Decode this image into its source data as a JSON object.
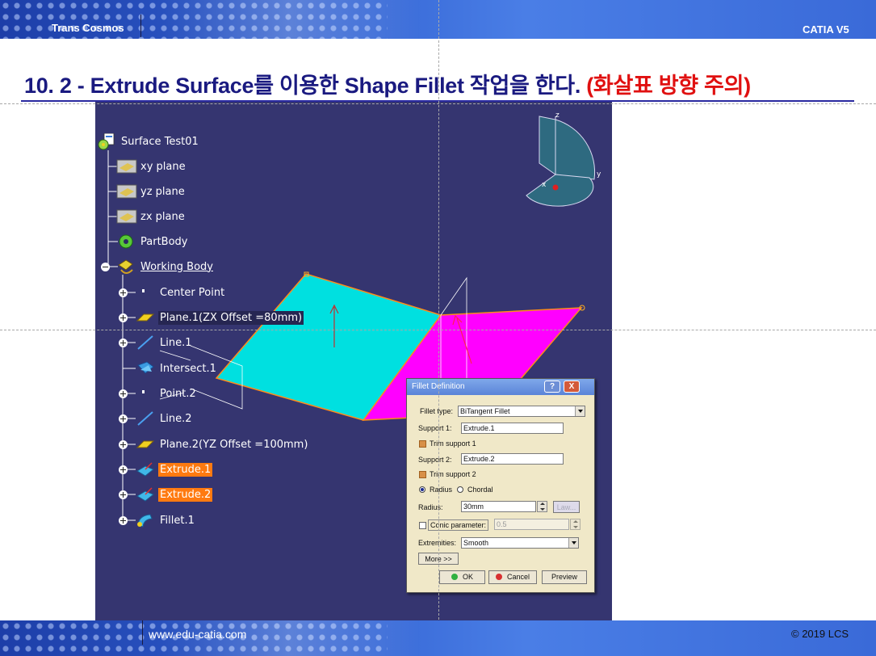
{
  "header": {
    "left_label": "Trans Cosmos",
    "right_label": "CATIA V5"
  },
  "title": {
    "main": "10. 2 - Extrude Surface를 이용한 Shape Fillet 작업을 한다. ",
    "note": "(화살표 방향 주의)"
  },
  "tree": {
    "items": [
      {
        "label": "Surface Test01",
        "icon": "part-document-icon"
      },
      {
        "label": "xy plane",
        "icon": "plane-icon"
      },
      {
        "label": "yz plane",
        "icon": "plane-icon"
      },
      {
        "label": "zx plane",
        "icon": "plane-icon"
      },
      {
        "label": "PartBody",
        "icon": "partbody-gear-icon"
      },
      {
        "label": "Working Body",
        "icon": "open-body-icon"
      },
      {
        "label": "Center Point",
        "icon": "point-icon"
      },
      {
        "label": "Plane.1(ZX Offset =80mm)",
        "icon": "plane-feature-icon"
      },
      {
        "label": "Line.1",
        "icon": "line-icon"
      },
      {
        "label": "Intersect.1",
        "icon": "intersect-icon"
      },
      {
        "label": "Point.2",
        "icon": "point-icon"
      },
      {
        "label": "Line.2",
        "icon": "line-icon"
      },
      {
        "label": "Plane.2(YZ Offset =100mm)",
        "icon": "plane-feature-icon"
      },
      {
        "label": "Extrude.1",
        "icon": "extrude-icon"
      },
      {
        "label": "Extrude.2",
        "icon": "extrude-icon"
      },
      {
        "label": "Fillet.1",
        "icon": "fillet-icon"
      }
    ]
  },
  "compass": {
    "z_label": "z",
    "y_label": "y",
    "x_label": "x"
  },
  "dialog": {
    "title": "Fillet Definition",
    "help_label": "?",
    "close_label": "X",
    "fillet_type_label": "Fillet type:",
    "fillet_type_value": "BiTangent Fillet",
    "support1_label": "Support 1:",
    "support1_value": "Extrude.1",
    "trim_support1_label": "Trim support 1",
    "support2_label": "Support 2:",
    "support2_value": "Extrude.2",
    "trim_support2_label": "Trim support 2",
    "radius_option_label": "Radius",
    "chordal_option_label": "Chordal",
    "radius_label": "Radius:",
    "radius_value": "30mm",
    "law_label": "Law...",
    "conic_label": "Conic parameter:",
    "conic_value": "0.5",
    "extremities_label": "Extremities:",
    "extremities_value": "Smooth",
    "more_label": "More >>",
    "ok_label": "OK",
    "cancel_label": "Cancel",
    "preview_label": "Preview"
  },
  "footer": {
    "website": "www.edu-catia.com",
    "copyright": "© 2019 LCS"
  },
  "colors": {
    "viewport_bg": "#353570",
    "surface_extrude1": "#00e0e0",
    "surface_extrude2": "#ff00ff",
    "edge": "#ff8c1a",
    "highlight": "#ff7a10",
    "title_blue": "#1a1a80",
    "title_red": "#e01010"
  }
}
